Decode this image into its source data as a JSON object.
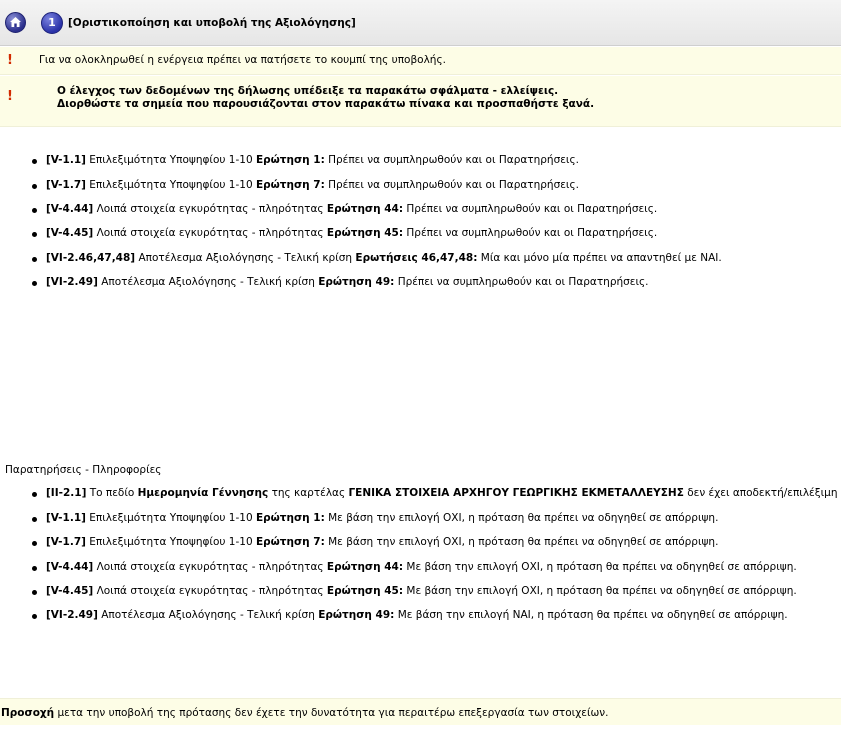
{
  "header": {
    "step_number": "1",
    "title": "[Οριστικοποίηση και υποβολή της Αξιολόγησης]",
    "home_icon": "home-icon"
  },
  "messages": {
    "info": "Για να ολοκληρωθεί η ενέργεια πρέπει να πατήσετε το κουμπί της υποβολής.",
    "error_line1": "Ο έλεγχος των δεδομένων της δήλωσης υπέδειξε τα παρακάτω σφάλματα - ελλείψεις.",
    "error_line2": "Διορθώστε τα σημεία που παρουσιάζονται στον παρακάτω πίνακα και προσπαθήστε ξανά."
  },
  "errors": [
    {
      "code": "[V-1.1]",
      "section": "Επιλεξιμότητα Υποψηφίου 1-10",
      "question": "Ερώτηση 1:",
      "text": "Πρέπει να συμπληρωθούν και οι Παρατηρήσεις."
    },
    {
      "code": "[V-1.7]",
      "section": "Επιλεξιμότητα Υποψηφίου 1-10",
      "question": "Ερώτηση 7:",
      "text": "Πρέπει να συμπληρωθούν και οι Παρατηρήσεις."
    },
    {
      "code": "[V-4.44]",
      "section": "Λοιπά στοιχεία εγκυρότητας - πληρότητας",
      "question": "Ερώτηση 44:",
      "text": "Πρέπει να συμπληρωθούν και οι Παρατηρήσεις."
    },
    {
      "code": "[V-4.45]",
      "section": "Λοιπά στοιχεία εγκυρότητας - πληρότητας",
      "question": "Ερώτηση 45:",
      "text": "Πρέπει να συμπληρωθούν και οι Παρατηρήσεις."
    },
    {
      "code": "[VI-2.46,47,48]",
      "section": "Αποτέλεσμα Αξιολόγησης - Τελική κρίση",
      "question": "Ερωτήσεις 46,47,48:",
      "text": "Μία και μόνο μία πρέπει να απαντηθεί με ΝΑΙ."
    },
    {
      "code": "[VI-2.49]",
      "section": "Αποτέλεσμα Αξιολόγησης - Τελική κρίση",
      "question": "Ερώτηση 49:",
      "text": "Πρέπει να συμπληρωθούν και οι Παρατηρήσεις."
    }
  ],
  "observations_title": "Παρατηρήσεις - Πληροφορίες",
  "observations": {
    "first": {
      "code": "[II-2.1]",
      "pre": "Το πεδίο",
      "field": "Ημερομηνία Γέννησης",
      "mid": "της καρτέλας",
      "tab": "ΓΕΝΙΚΑ ΣΤΟΙΧΕΙΑ ΑΡΧΗΓΟΥ ΓΕΩΡΓΙΚΗΣ ΕΚΜΕΤΑΛΛΕΥΣΗΣ",
      "post": "δεν έχει αποδεκτή/επιλέξιμη τιμή."
    },
    "items": [
      {
        "code": "[V-1.1]",
        "section": "Επιλεξιμότητα Υποψηφίου 1-10",
        "question": "Ερώτηση 1:",
        "text": "Με βάση την επιλογή ΟΧΙ, η πρόταση θα πρέπει να οδηγηθεί σε απόρριψη."
      },
      {
        "code": "[V-1.7]",
        "section": "Επιλεξιμότητα Υποψηφίου 1-10",
        "question": "Ερώτηση 7:",
        "text": "Με βάση την επιλογή ΟΧΙ, η πρόταση θα πρέπει να οδηγηθεί σε απόρριψη."
      },
      {
        "code": "[V-4.44]",
        "section": "Λοιπά στοιχεία εγκυρότητας - πληρότητας",
        "question": "Ερώτηση 44:",
        "text": "Με βάση την επιλογή ΟΧΙ, η πρόταση θα πρέπει να οδηγηθεί σε απόρριψη."
      },
      {
        "code": "[V-4.45]",
        "section": "Λοιπά στοιχεία εγκυρότητας - πληρότητας",
        "question": "Ερώτηση 45:",
        "text": "Με βάση την επιλογή ΟΧΙ, η πρόταση θα πρέπει να οδηγηθεί σε απόρριψη."
      },
      {
        "code": "[VI-2.49]",
        "section": "Αποτέλεσμα Αξιολόγησης - Τελική κρίση",
        "question": "Ερώτηση 49:",
        "text": "Με βάση την επιλογή ΝΑΙ, η πρόταση θα πρέπει να οδηγηθεί σε απόρριψη."
      }
    ]
  },
  "footer": {
    "bold": "Προσοχή",
    "text": "μετα την υποβολή της πρότασης δεν έχετε την δυνατότητα για περαιτέρω επεξεργασία των στοιχείων."
  }
}
